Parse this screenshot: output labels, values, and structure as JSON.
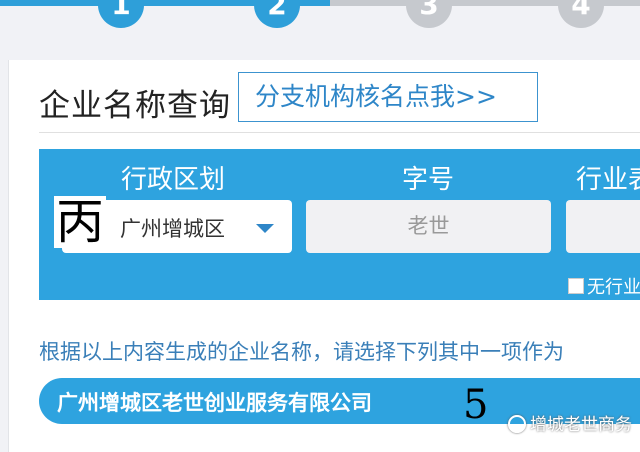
{
  "steps": [
    {
      "number": "1",
      "state": "done"
    },
    {
      "number": "2",
      "state": "done"
    },
    {
      "number": "3",
      "state": "todo"
    },
    {
      "number": "4",
      "state": "todo"
    }
  ],
  "header": {
    "title": "企业名称查询",
    "branch_link": "分支机构核名点我>>"
  },
  "form": {
    "region_label": "行政区划",
    "region_value": "广州增城区",
    "name_label": "字号",
    "name_placeholder": "老世",
    "industry_label": "行业表",
    "no_industry_label": "无行业"
  },
  "hint_text": "根据以上内容生成的企业名称，请选择下列其中一项作为",
  "results": [
    {
      "name": "广州增城区老世创业服务有限公司"
    }
  ],
  "overlays": {
    "char_bing": "丙",
    "digit_five": "5"
  },
  "watermark": {
    "text": "增城老世商务",
    "icon": "wechat-official-icon"
  },
  "colors": {
    "accent": "#2ea3df",
    "step_inactive": "#c6c9ce",
    "link": "#2e86c8"
  }
}
